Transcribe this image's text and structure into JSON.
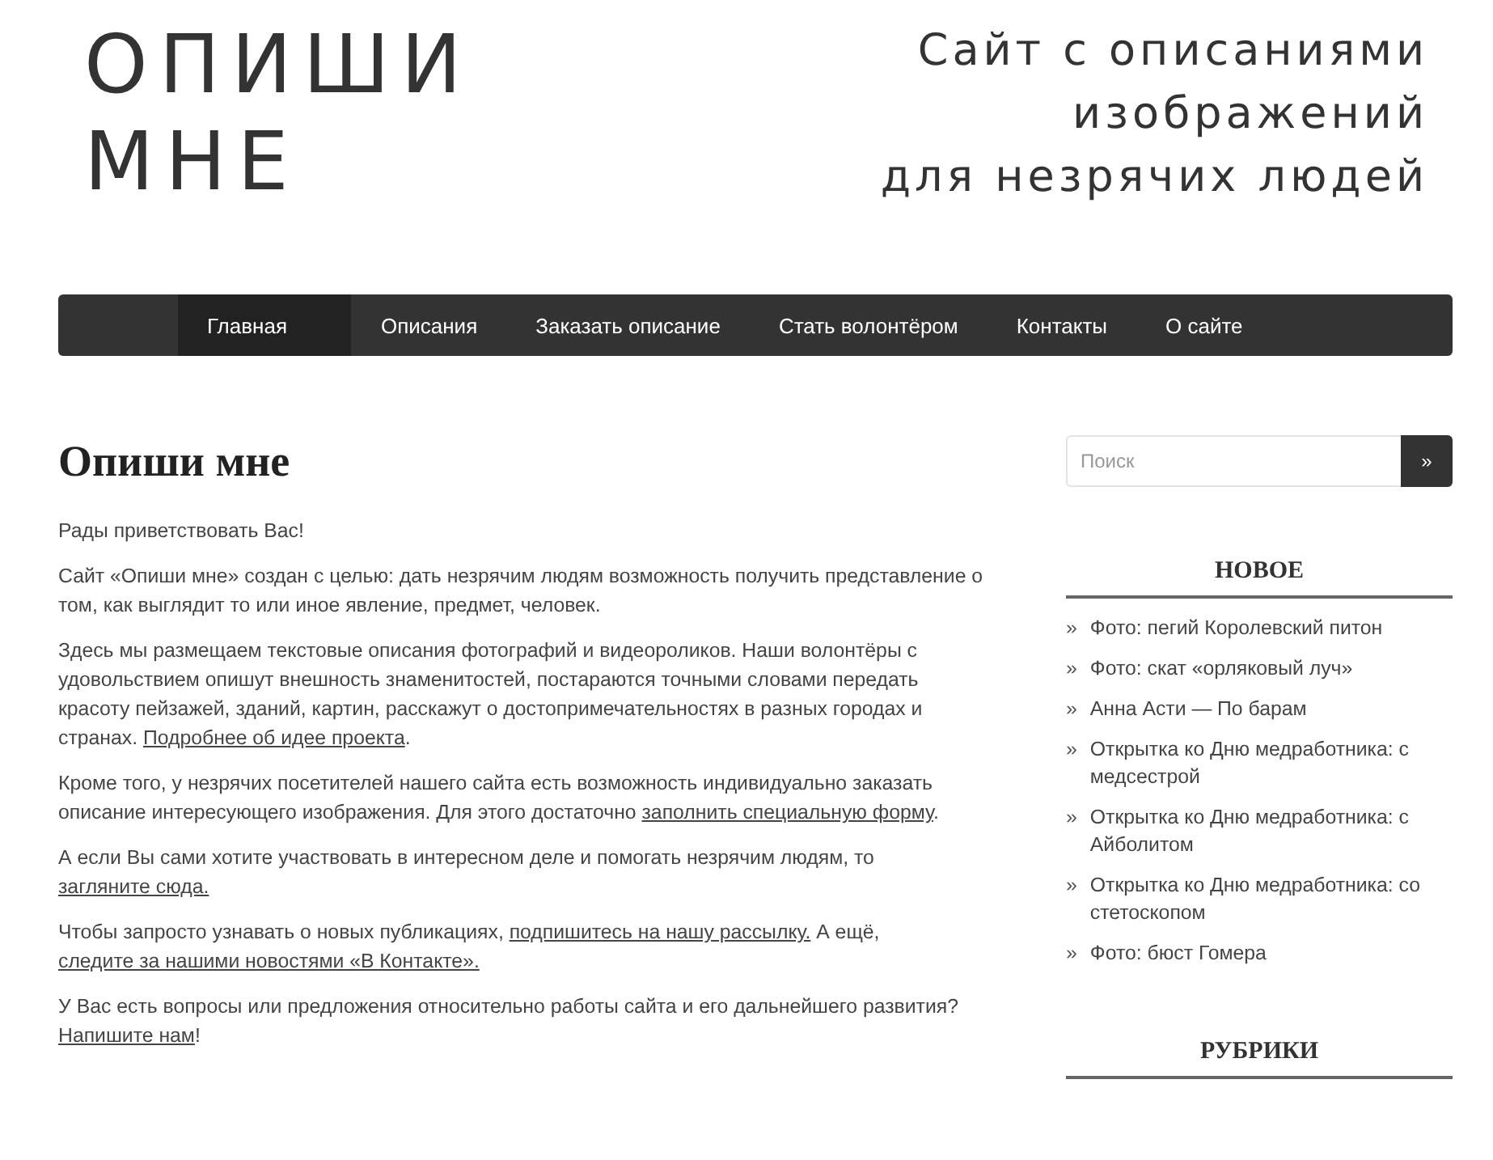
{
  "logo": [
    "ОПИШИ",
    "МНЕ"
  ],
  "tagline": [
    "Сайт с описаниями",
    "изображений",
    "для незрячих людей"
  ],
  "nav": [
    {
      "label": "Главная",
      "selected": true
    },
    {
      "label": "Описания",
      "selected": false
    },
    {
      "label": "Заказать описание",
      "selected": false
    },
    {
      "label": "Стать волонтёром",
      "selected": false
    },
    {
      "label": "Контакты",
      "selected": false
    },
    {
      "label": "О сайте",
      "selected": false
    }
  ],
  "page_title": "Опиши мне",
  "paragraphs": [
    [
      {
        "text": "Рады приветствовать Вас!",
        "link": false
      }
    ],
    [
      {
        "text": "Сайт «Опиши мне» создан с целью: дать незрячим людям возможность получить представление о том, как выглядит то или иное явление, предмет, человек.",
        "link": false
      }
    ],
    [
      {
        "text": "Здесь мы размещаем текстовые описания фотографий и видеороликов. Наши волонтёры с удовольствием опишут внешность знаменитостей, постараются точными словами передать красоту пейзажей, зданий, картин, расскажут о достопримечательностях в разных городах и странах. ",
        "link": false
      },
      {
        "text": "Подробнее об идее проекта",
        "link": true
      },
      {
        "text": ".",
        "link": false
      }
    ],
    [
      {
        "text": "Кроме того, у незрячих посетителей нашего сайта есть возможность индивидуально заказать описание интересующего изображения. Для этого достаточно ",
        "link": false
      },
      {
        "text": "заполнить специальную форму",
        "link": true
      },
      {
        "text": ".",
        "link": false
      }
    ],
    [
      {
        "text": "А если Вы сами хотите участвовать в интересном деле и помогать незрячим людям, то ",
        "link": false
      },
      {
        "text": "загляните сюда.",
        "link": true
      }
    ],
    [
      {
        "text": "Чтобы запросто узнавать о новых публикациях, ",
        "link": false
      },
      {
        "text": "подпишитесь на нашу рассылку.",
        "link": true
      },
      {
        "text": " А ещё, ",
        "link": false
      },
      {
        "text": "следите за нашими новостями «В Контакте».",
        "link": true
      }
    ],
    [
      {
        "text": "У Вас есть вопросы или предложения относительно работы сайта и его дальнейшего развития? ",
        "link": false
      },
      {
        "text": "Напишите нам",
        "link": true
      },
      {
        "text": "!",
        "link": false
      }
    ]
  ],
  "search": {
    "placeholder": "Поиск",
    "button": "»"
  },
  "widgets": [
    {
      "title": "НОВОЕ",
      "items": [
        {
          "bullet": "»",
          "label": "Фото: пегий Королевский питон"
        },
        {
          "bullet": "»",
          "label": "Фото: скат «орляковый луч»"
        },
        {
          "bullet": "»",
          "label": "Анна Асти — По барам"
        },
        {
          "bullet": "»",
          "label": "Открытка ко Дню медработника: с медсестрой"
        },
        {
          "bullet": "»",
          "label": "Открытка ко Дню медработника: с Айболитом"
        },
        {
          "bullet": "»",
          "label": "Открытка ко Дню медработника: со стетоскопом"
        },
        {
          "bullet": "»",
          "label": "Фото: бюст Гомера"
        }
      ]
    },
    {
      "title": "РУБРИКИ"
    }
  ]
}
